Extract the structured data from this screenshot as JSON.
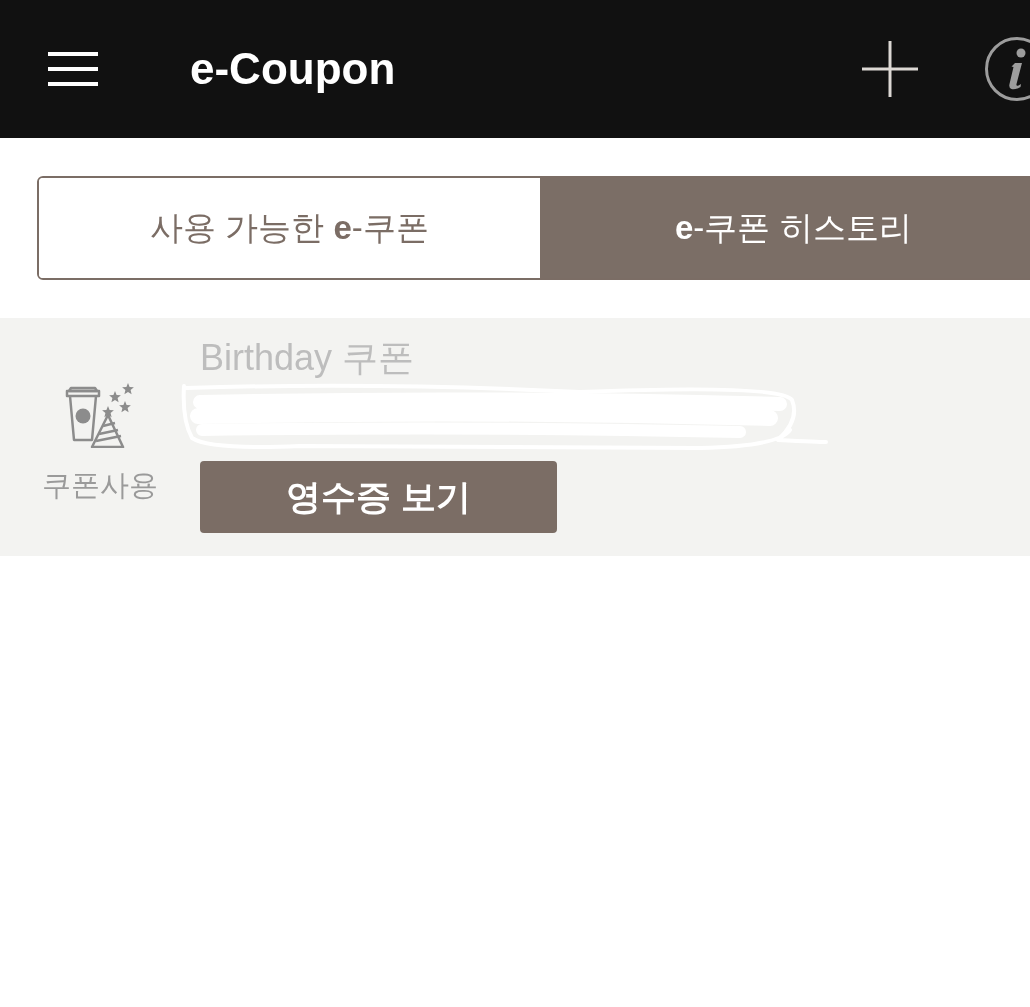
{
  "header": {
    "title": "e-Coupon"
  },
  "tabs": [
    {
      "label": "사용 가능한 **e**-쿠폰",
      "selected": false
    },
    {
      "label": "**e**-쿠폰 히스토리",
      "selected": true
    }
  ],
  "coupons": [
    {
      "status": "쿠폰사용",
      "name": "Birthday 쿠폰",
      "redacted": true,
      "button": "영수증 보기"
    }
  ]
}
